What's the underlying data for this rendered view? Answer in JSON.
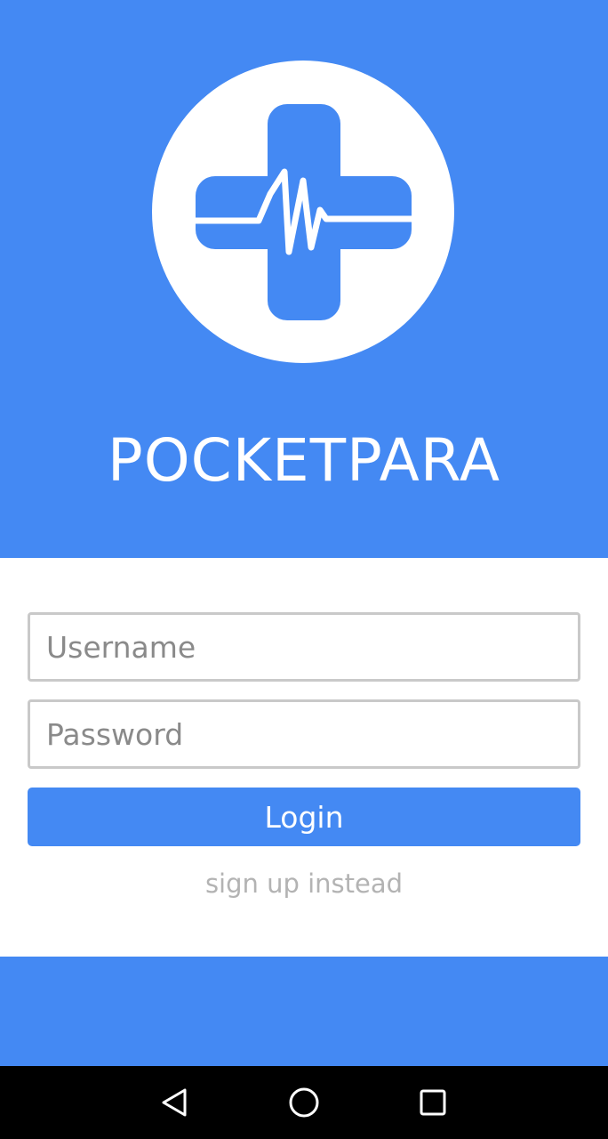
{
  "app": {
    "title": "POCKETPARA",
    "logo_icon": "medical-cross-heartbeat-icon",
    "brand_color": "#4489f3"
  },
  "login_form": {
    "username_placeholder": "Username",
    "password_placeholder": "Password",
    "login_label": "Login",
    "signup_label": "sign up instead"
  },
  "nav_bar": {
    "back_icon": "back-triangle-icon",
    "home_icon": "home-circle-icon",
    "recents_icon": "recents-square-icon"
  }
}
